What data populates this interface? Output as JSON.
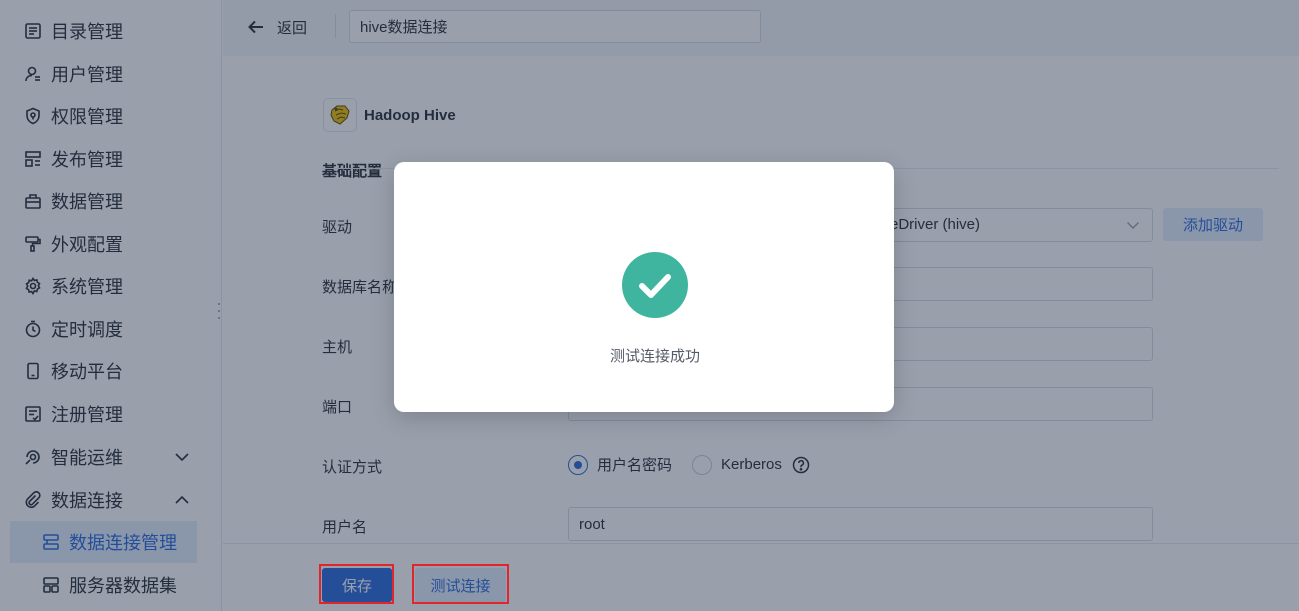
{
  "sidebar": {
    "items": [
      {
        "label": "目录管理",
        "icon": "list-icon"
      },
      {
        "label": "用户管理",
        "icon": "user-icon"
      },
      {
        "label": "权限管理",
        "icon": "shield-icon"
      },
      {
        "label": "发布管理",
        "icon": "publish-icon"
      },
      {
        "label": "数据管理",
        "icon": "database-icon"
      },
      {
        "label": "外观配置",
        "icon": "paint-roller-icon"
      },
      {
        "label": "系统管理",
        "icon": "gear-icon"
      },
      {
        "label": "定时调度",
        "icon": "stopwatch-icon"
      },
      {
        "label": "移动平台",
        "icon": "mobile-icon"
      },
      {
        "label": "注册管理",
        "icon": "register-icon"
      },
      {
        "label": "智能运维",
        "icon": "ops-icon",
        "expanded": false
      },
      {
        "label": "数据连接",
        "icon": "link-icon",
        "expanded": true
      }
    ],
    "sub_items": [
      {
        "label": "数据连接管理",
        "icon": "connection-icon",
        "active": true
      },
      {
        "label": "服务器数据集",
        "icon": "server-dataset-icon",
        "active": false
      }
    ]
  },
  "topbar": {
    "back_label": "返回",
    "name_value": "hive数据连接"
  },
  "form": {
    "brand_name": "Hadoop Hive",
    "section_title": "基础配置",
    "driver_label": "驱动",
    "driver_value": "eDriver (hive)",
    "add_driver_label": "添加驱动",
    "dbname_label": "数据库名称",
    "host_label": "主机",
    "port_label": "端口",
    "auth_label": "认证方式",
    "auth_options": [
      "用户名密码",
      "Kerberos"
    ],
    "auth_selected": "用户名密码",
    "username_label": "用户名",
    "username_value": "root"
  },
  "footer": {
    "save_label": "保存",
    "test_label": "测试连接"
  },
  "modal": {
    "message": "测试连接成功"
  },
  "colors": {
    "primary": "#2d6bdc",
    "success": "#3fb59f",
    "highlight": "#e0262c",
    "overlay": "#1d2c48"
  }
}
